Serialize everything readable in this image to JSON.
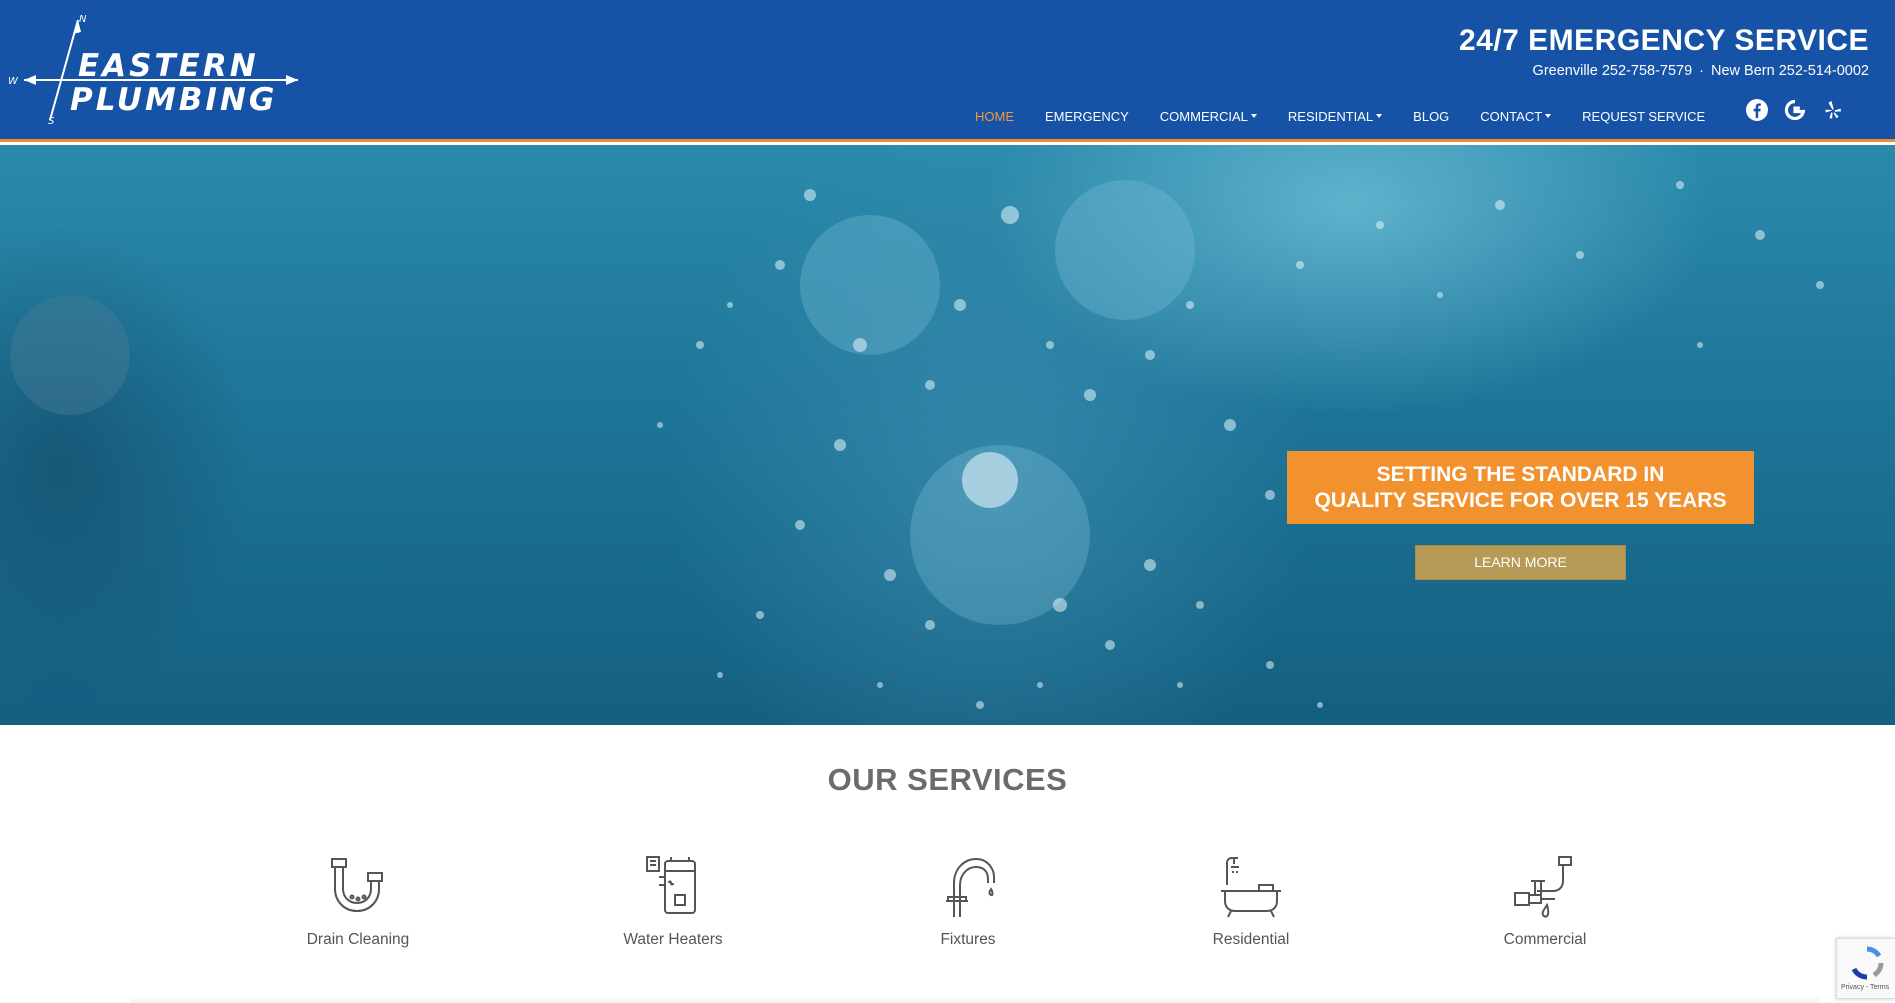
{
  "header": {
    "logo": {
      "line1": "Eastern",
      "line2": "Plumbing",
      "compass": {
        "n": "N",
        "s": "S",
        "w": "W"
      }
    },
    "emergency_title": "24/7  EMERGENCY SERVICE",
    "phones": {
      "greenville": "Greenville 252-758-7579",
      "separator": "·",
      "new_bern": "New Bern 252-514-0002"
    },
    "nav": [
      {
        "label": "Home"
      },
      {
        "label": "Emergency"
      },
      {
        "label": "Commercial"
      },
      {
        "label": "Residential"
      },
      {
        "label": "Blog"
      },
      {
        "label": "Contact"
      },
      {
        "label": "Request Service"
      }
    ],
    "social": [
      "facebook-icon",
      "google-icon",
      "yelp-icon"
    ]
  },
  "hero": {
    "tagline_line1": "Setting the standard in",
    "tagline_line2": "quality service for over 15 years",
    "cta": "Learn More"
  },
  "services": {
    "title": "OUR SERVICES",
    "items": [
      {
        "label": "Drain Cleaning",
        "icon": "drain-pipe-icon"
      },
      {
        "label": "Water Heaters",
        "icon": "water-heater-icon"
      },
      {
        "label": "Fixtures",
        "icon": "faucet-icon"
      },
      {
        "label": "Residential",
        "icon": "bathtub-icon"
      },
      {
        "label": "Commercial",
        "icon": "pipe-valve-icon"
      }
    ]
  },
  "recaptcha": {
    "text": "Privacy - Terms"
  },
  "colors": {
    "header_bg": "#1652a6",
    "accent_orange": "#f2922f",
    "nav_active": "#f39a3a",
    "cta_bg": "#b79a55"
  }
}
